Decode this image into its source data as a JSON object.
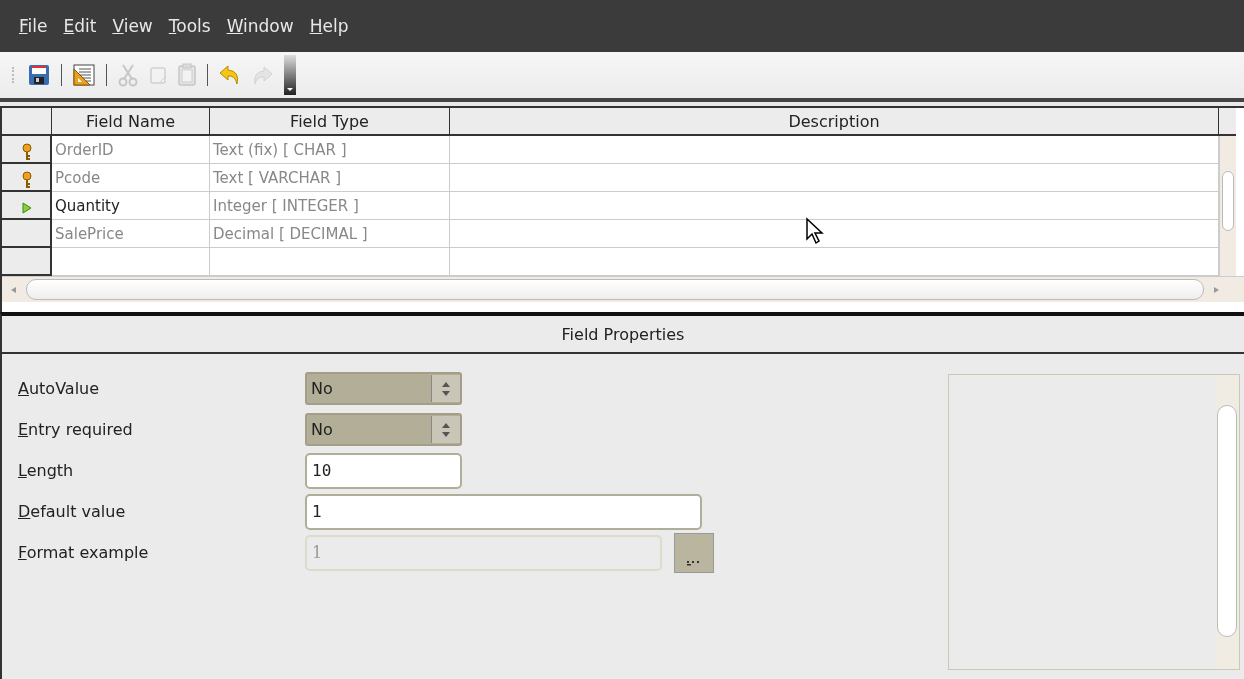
{
  "menu": [
    "File",
    "Edit",
    "View",
    "Tools",
    "Window",
    "Help"
  ],
  "toolbar": [
    {
      "kind": "save",
      "disabled": false
    },
    {
      "kind": "separator"
    },
    {
      "kind": "design",
      "disabled": false
    },
    {
      "kind": "separator"
    },
    {
      "kind": "cut",
      "disabled": true
    },
    {
      "kind": "copy",
      "disabled": true
    },
    {
      "kind": "paste",
      "disabled": true
    },
    {
      "kind": "separator"
    },
    {
      "kind": "undo",
      "disabled": false
    },
    {
      "kind": "redo",
      "disabled": true
    },
    {
      "kind": "more"
    }
  ],
  "table": {
    "columns": [
      "Field Name",
      "Field Type",
      "Description"
    ],
    "rows": [
      {
        "primary_key": true,
        "name": "OrderID",
        "type": "Text (fix) [ CHAR ]",
        "selected": false
      },
      {
        "primary_key": true,
        "name": "Pcode",
        "type": "Text [ VARCHAR ]",
        "selected": false
      },
      {
        "primary_key": false,
        "name": "Quantity",
        "type": "Integer [ INTEGER ]",
        "selected": true
      },
      {
        "primary_key": false,
        "name": "SalePrice",
        "type": "Decimal [ DECIMAL ]",
        "selected": false
      }
    ]
  },
  "properties": {
    "title": "Field Properties",
    "items": [
      {
        "kind": "spin",
        "label": "AutoValue",
        "value": "No",
        "disabled": false
      },
      {
        "kind": "spin",
        "label": "Entry required",
        "value": "No",
        "disabled": false
      },
      {
        "kind": "short-text",
        "label": "Length",
        "value": "10",
        "disabled": false
      },
      {
        "kind": "text",
        "label": "Default value",
        "value": "1",
        "disabled": false
      },
      {
        "kind": "format",
        "label": "Format example",
        "value": "1",
        "disabled": true
      }
    ]
  }
}
